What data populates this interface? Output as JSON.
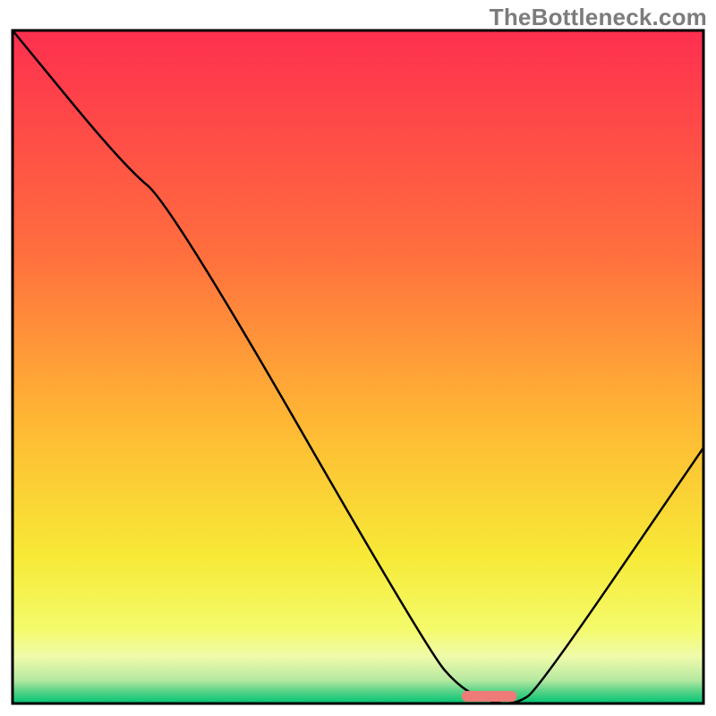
{
  "watermark": "TheBottleneck.com",
  "chart_data": {
    "type": "line",
    "title": "",
    "xlabel": "",
    "ylabel": "",
    "xlim": [
      0,
      100
    ],
    "ylim": [
      0,
      100
    ],
    "x": [
      0,
      16,
      23,
      60,
      65,
      70,
      73,
      76,
      100
    ],
    "values": [
      100,
      80,
      74,
      8,
      2,
      0,
      0,
      2,
      38
    ],
    "marker": {
      "x_range": [
        65,
        73
      ],
      "color": "#ee7b77"
    },
    "gradient_stops": [
      {
        "pct": 0,
        "color": "#fe2f4f"
      },
      {
        "pct": 33,
        "color": "#ff6e3e"
      },
      {
        "pct": 58,
        "color": "#ffb734"
      },
      {
        "pct": 78,
        "color": "#f7e936"
      },
      {
        "pct": 89,
        "color": "#f4fb6b"
      },
      {
        "pct": 93,
        "color": "#effbaa"
      },
      {
        "pct": 96.5,
        "color": "#b7e9a1"
      },
      {
        "pct": 98,
        "color": "#61d58a"
      },
      {
        "pct": 100,
        "color": "#00c373"
      }
    ],
    "border_color": "#000000"
  }
}
